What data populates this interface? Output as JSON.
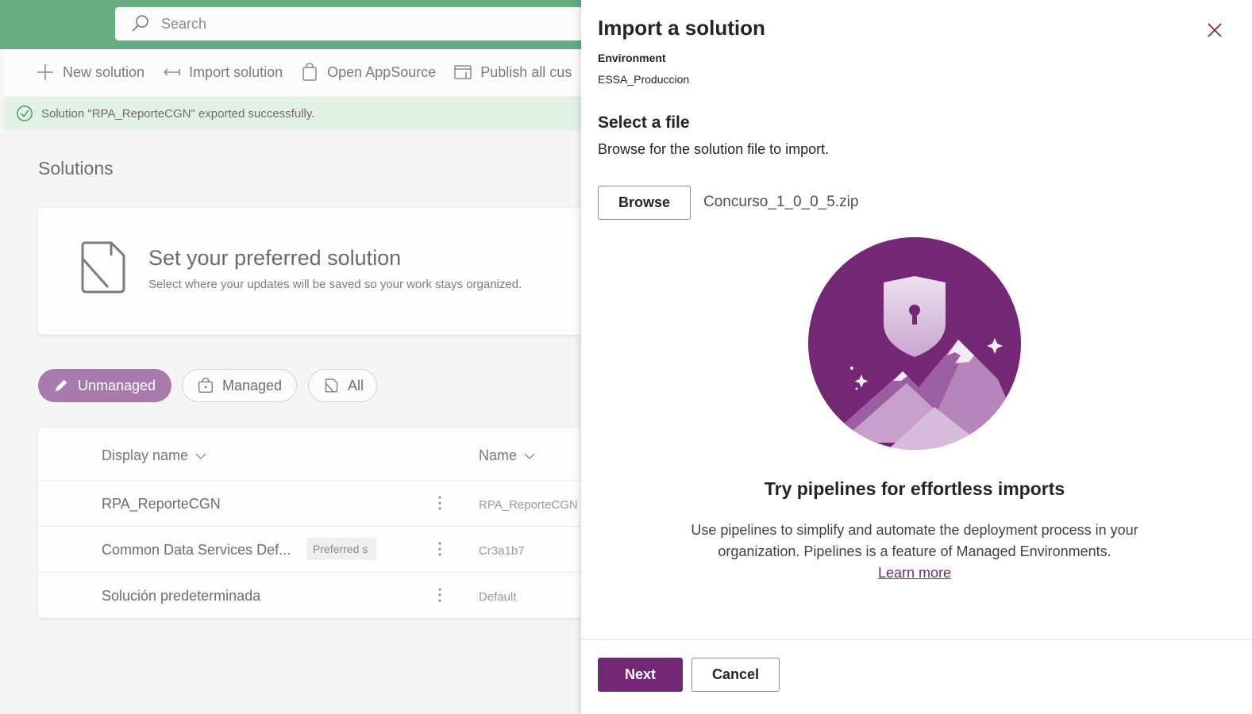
{
  "topbar": {
    "search_placeholder": "Search"
  },
  "commands": {
    "new_solution": "New solution",
    "import_solution": "Import solution",
    "open_appsource": "Open AppSource",
    "publish_all": "Publish all cus"
  },
  "message": {
    "text": "Solution \"RPA_ReporteCGN\" exported successfully."
  },
  "main": {
    "title": "Solutions",
    "preferred": {
      "title": "Set your preferred solution",
      "subtitle": "Select where your updates will be saved so your work stays organized."
    },
    "filters": {
      "unmanaged": "Unmanaged",
      "managed": "Managed",
      "all": "All"
    },
    "grid": {
      "col_display_name": "Display name",
      "col_name": "Name",
      "rows": [
        {
          "display_name": "RPA_ReporteCGN",
          "name": "RPA_ReporteCGN",
          "badge": ""
        },
        {
          "display_name": "Common Data Services Def...",
          "name": "Cr3a1b7",
          "badge": "Preferred s"
        },
        {
          "display_name": "Solución predeterminada",
          "name": "Default",
          "badge": ""
        }
      ]
    }
  },
  "panel": {
    "title": "Import a solution",
    "environment_label": "Environment",
    "environment_value": "ESSA_Produccion",
    "select_file_title": "Select a file",
    "select_file_desc": "Browse for the solution file to import.",
    "browse_label": "Browse",
    "file_name": "Concurso_1_0_0_5.zip",
    "promo_title": "Try pipelines for effortless imports",
    "promo_text": "Use pipelines to simplify and automate the deployment process in your organization. Pipelines is a feature of Managed Environments.",
    "learn_more": "Learn more",
    "next_label": "Next",
    "cancel_label": "Cancel"
  },
  "colors": {
    "header_green": "#67ab80",
    "accent_purple": "#742774",
    "pill_purple": "#a77cac",
    "success_bg": "#e2f1e5"
  }
}
